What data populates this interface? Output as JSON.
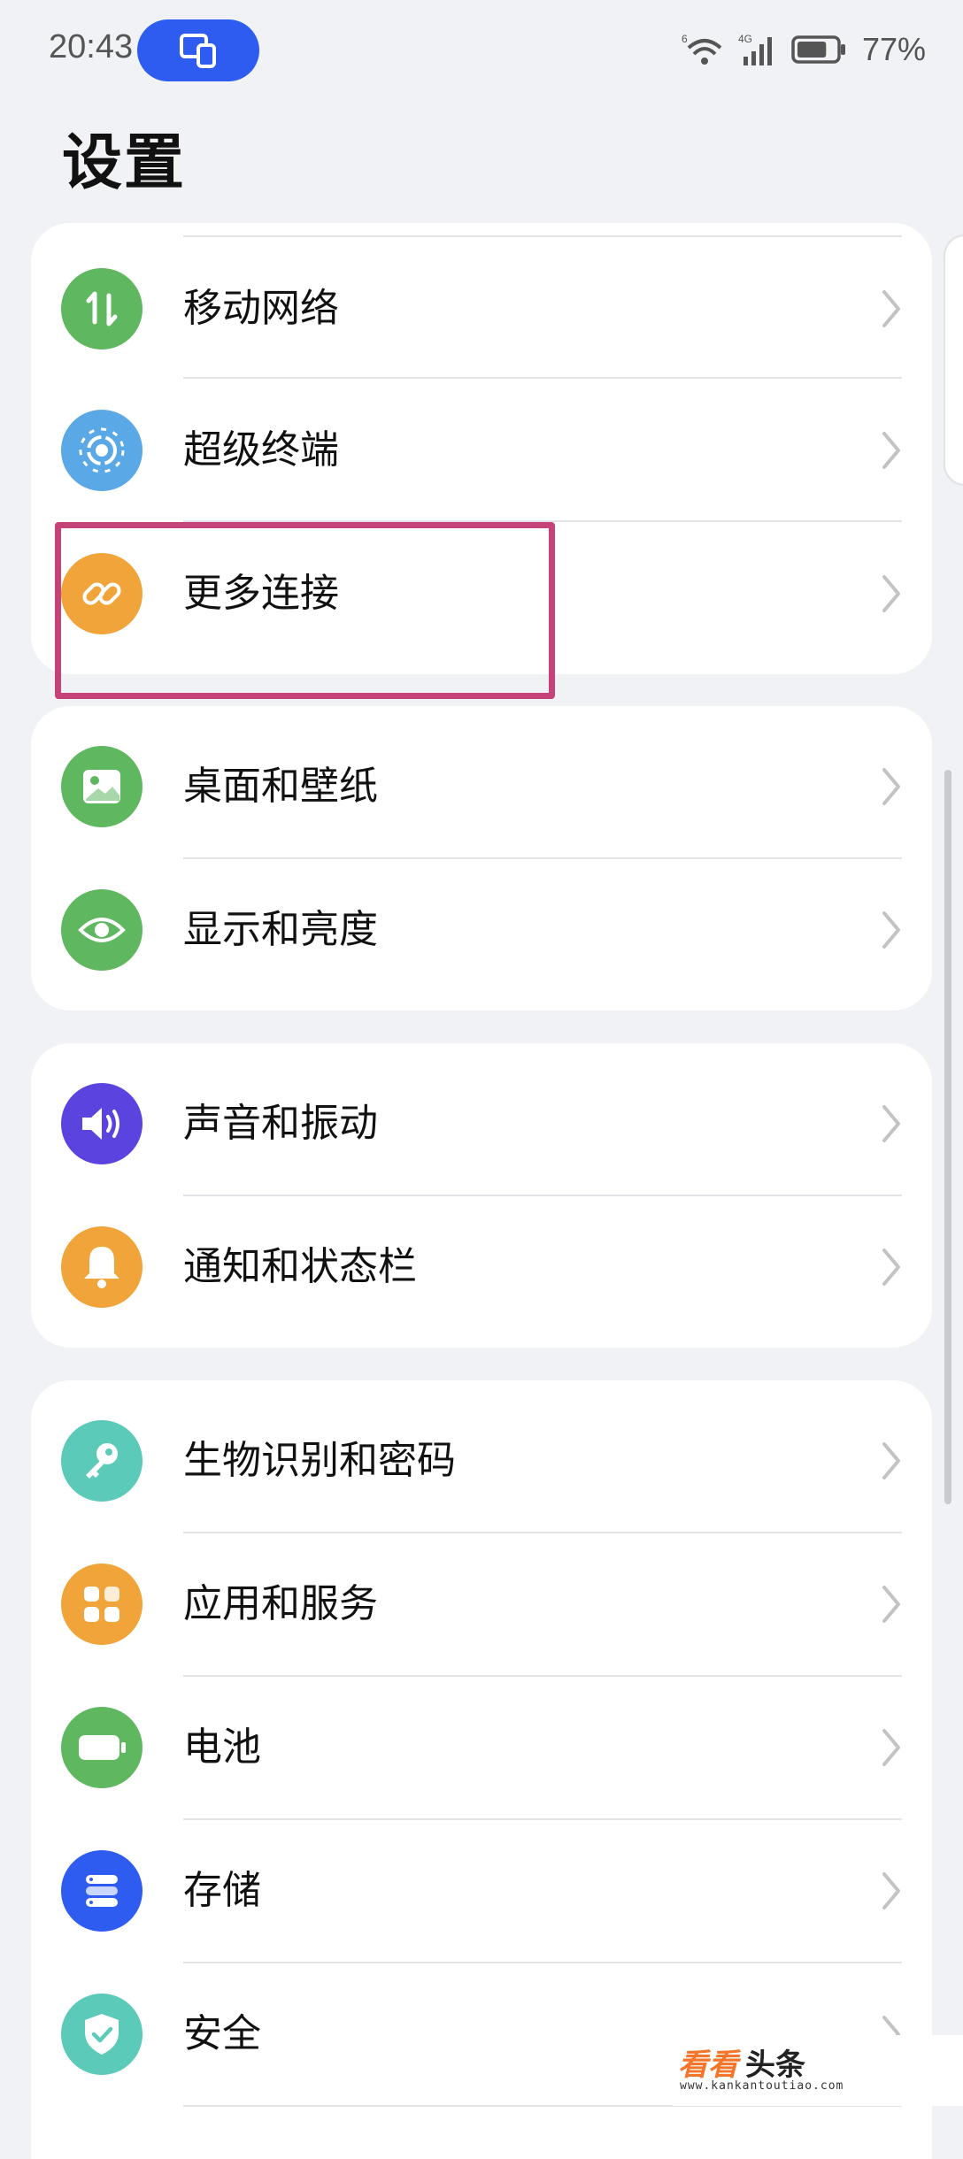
{
  "status_bar": {
    "time": "20:43",
    "network": "4G",
    "wifi_mark": "6",
    "battery_percent": "77%",
    "battery_level": 0.77
  },
  "title": "设置",
  "cards": [
    {
      "items": [
        {
          "label": "移动网络",
          "icon": "mobile-data-icon",
          "color": "#5fb760"
        },
        {
          "label": "超级终端",
          "icon": "super-device-icon",
          "color": "#5aa8e6"
        },
        {
          "label": "更多连接",
          "icon": "link-icon",
          "color": "#f0a43a",
          "highlighted": true
        }
      ]
    },
    {
      "items": [
        {
          "label": "桌面和壁纸",
          "icon": "wallpaper-icon",
          "color": "#5fb760"
        },
        {
          "label": "显示和亮度",
          "icon": "eye-icon",
          "color": "#5fb760"
        }
      ]
    },
    {
      "items": [
        {
          "label": "声音和振动",
          "icon": "speaker-icon",
          "color": "#5b43e0"
        },
        {
          "label": "通知和状态栏",
          "icon": "bell-icon",
          "color": "#f0a43a"
        }
      ]
    },
    {
      "items": [
        {
          "label": "生物识别和密码",
          "icon": "key-icon",
          "color": "#5ccab8"
        },
        {
          "label": "应用和服务",
          "icon": "apps-icon",
          "color": "#f0a43a"
        },
        {
          "label": "电池",
          "icon": "battery-icon",
          "color": "#5fb760"
        },
        {
          "label": "存储",
          "icon": "storage-icon",
          "color": "#2f5cf0"
        },
        {
          "label": "安全",
          "icon": "shield-icon",
          "color": "#5ccab8"
        }
      ]
    }
  ],
  "watermark": {
    "part1": "看看",
    "part2": "头条",
    "url": "www.kankantoutiao.com"
  }
}
